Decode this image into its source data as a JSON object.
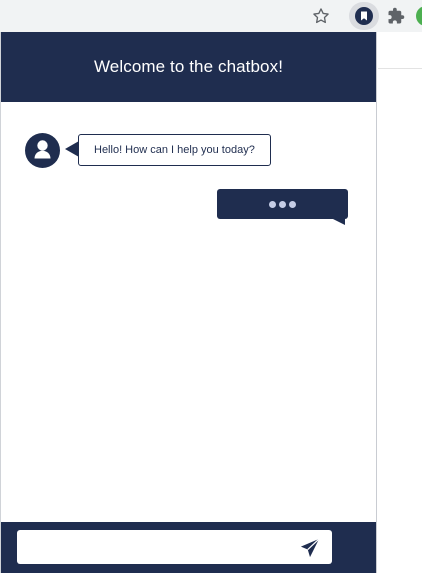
{
  "browser": {
    "toolbar_icons": [
      "star-icon",
      "chatbox-extension-icon",
      "puzzle-icon",
      "profile-avatar"
    ]
  },
  "chat": {
    "title": "Welcome to the chatbox!",
    "messages": [
      {
        "sender": "bot",
        "text": "Hello! How can I help you today?"
      },
      {
        "sender": "user",
        "typing": true,
        "indicator": "•••"
      }
    ],
    "input": {
      "value": "",
      "placeholder": ""
    },
    "send_icon": "send-icon"
  },
  "colors": {
    "primary": "#1f2d4f",
    "typing_dots": "#c5cde6",
    "browser_bar": "#f1f3f4",
    "profile": "#4caf50"
  }
}
